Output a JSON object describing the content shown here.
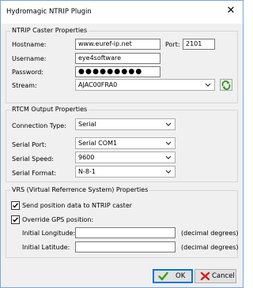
{
  "window": {
    "title": "Hydromagic NTRIP Plugin"
  },
  "caster": {
    "legend": "NTRIP Caster Properties",
    "hostname_label": "Hostname:",
    "hostname_value": "www.euref-ip.net",
    "port_label": "Port:",
    "port_value": "2101",
    "username_label": "Username:",
    "username_value": "eye4software",
    "password_label": "Password:",
    "password_value": "●●●●●●●●●",
    "stream_label": "Stream:",
    "stream_value": "AJAC00FRA0"
  },
  "rtcm": {
    "legend": "RTCM Output Properties",
    "connection_type_label": "Connection Type:",
    "connection_type_value": "Serial",
    "serial_port_label": "Serial Port:",
    "serial_port_value": "Serial COM1",
    "serial_speed_label": "Serial Speed:",
    "serial_speed_value": "9600",
    "serial_format_label": "Serial Format:",
    "serial_format_value": "N-8-1"
  },
  "vrs": {
    "legend": "VRS (Virtual Referrence System) Properties",
    "send_position_label": "Send position data to NTRIP caster",
    "send_position_checked": true,
    "override_gps_label": "Override GPS position:",
    "override_gps_checked": true,
    "longitude_label": "Initial Longitude:",
    "longitude_value": "",
    "longitude_unit": "(decimal degrees)",
    "latitude_label": "Initial Latitude:",
    "latitude_value": "",
    "latitude_unit": "(decimal degrees)"
  },
  "buttons": {
    "ok_label": "OK",
    "cancel_label": "Cancel"
  },
  "colors": {
    "accent": "#0078d7",
    "ok_icon": "#3a9a1a",
    "cancel_icon": "#d61c1c",
    "refresh_icon": "#3c8c2a"
  }
}
